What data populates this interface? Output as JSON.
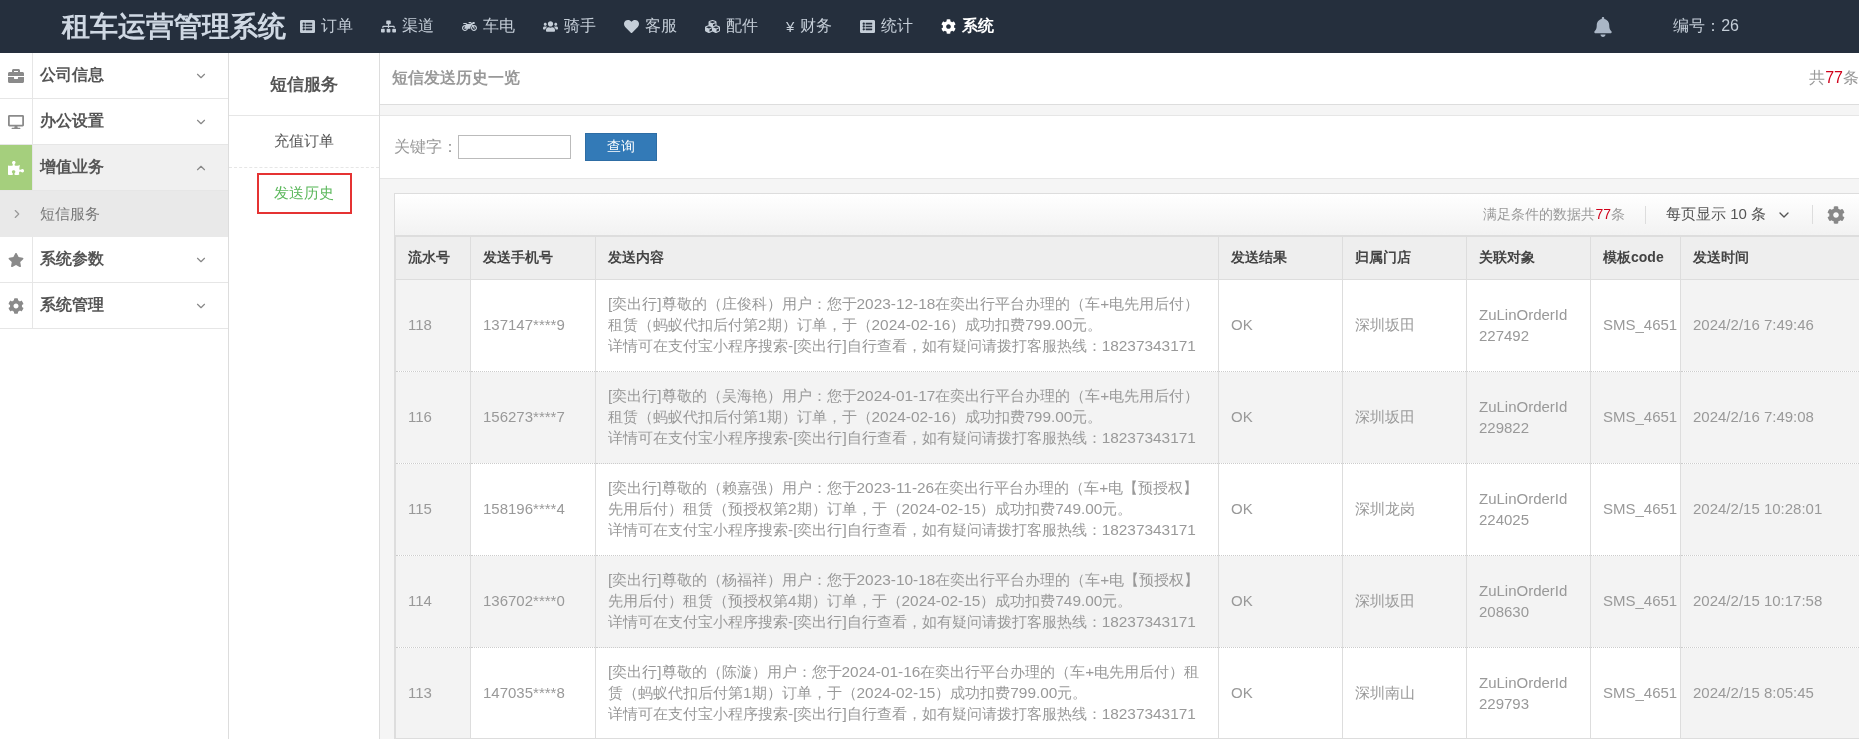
{
  "app_title": "租车运营管理系统",
  "nav": [
    {
      "label": "订单",
      "selected": false
    },
    {
      "label": "渠道",
      "selected": false
    },
    {
      "label": "车电",
      "selected": false
    },
    {
      "label": "骑手",
      "selected": false
    },
    {
      "label": "客服",
      "selected": false
    },
    {
      "label": "配件",
      "selected": false
    },
    {
      "label": "财务",
      "symbol": "¥",
      "selected": false
    },
    {
      "label": "统计",
      "selected": false
    },
    {
      "label": "系统",
      "selected": true
    }
  ],
  "user": {
    "id_label": "编号：26"
  },
  "sidebar": {
    "items": [
      {
        "label": "公司信息",
        "expanded": false,
        "selected": false
      },
      {
        "label": "办公设置",
        "expanded": false,
        "selected": false
      },
      {
        "label": "增值业务",
        "expanded": true,
        "selected": true,
        "children": [
          {
            "label": "短信服务",
            "selected": true
          }
        ]
      },
      {
        "label": "系统参数",
        "expanded": false,
        "selected": false
      },
      {
        "label": "系统管理",
        "expanded": false,
        "selected": false
      }
    ]
  },
  "subnav": {
    "title": "短信服务",
    "items": [
      {
        "label": "充值订单",
        "selected": false
      },
      {
        "label": "发送历史",
        "selected": true
      }
    ]
  },
  "page": {
    "title": "短信发送历史一览",
    "total": {
      "prefix": "共",
      "count": "77",
      "suffix": "条"
    }
  },
  "search": {
    "label": "关键字：",
    "button": "查询"
  },
  "table": {
    "summary": {
      "prefix": "满足条件的数据共",
      "count": "77",
      "suffix": "条"
    },
    "page_size": "每页显示 10 条",
    "columns": [
      "流水号",
      "发送手机号",
      "发送内容",
      "发送结果",
      "归属门店",
      "关联对象",
      "模板code",
      "发送时间"
    ],
    "rows": [
      [
        "118",
        "137147****9",
        [
          "[奕出行]尊敬的（庄俊科）用户：您于2023-12-18在奕出行平台办理的（车+电先用后付）租赁（蚂蚁代扣后付第2期）订单，于（2024-02-16）成功扣费799.00元。",
          "详情可在支付宝小程序搜索-[奕出行]自行查看，如有疑问请拨打客服热线：18237343171"
        ],
        "OK",
        "深圳坂田",
        "ZuLinOrderId 227492",
        "SMS_4651",
        "2024/2/16 7:49:46"
      ],
      [
        "116",
        "156273****7",
        [
          "[奕出行]尊敬的（吴海艳）用户：您于2024-01-17在奕出行平台办理的（车+电先用后付）租赁（蚂蚁代扣后付第1期）订单，于（2024-02-16）成功扣费799.00元。",
          "详情可在支付宝小程序搜索-[奕出行]自行查看，如有疑问请拨打客服热线：18237343171"
        ],
        "OK",
        "深圳坂田",
        "ZuLinOrderId 229822",
        "SMS_4651",
        "2024/2/16 7:49:08"
      ],
      [
        "115",
        "158196****4",
        [
          "[奕出行]尊敬的（赖嘉强）用户：您于2023-11-26在奕出行平台办理的（车+电【预授权】先用后付）租赁（预授权第2期）订单，于（2024-02-15）成功扣费749.00元。",
          "详情可在支付宝小程序搜索-[奕出行]自行查看，如有疑问请拨打客服热线：18237343171"
        ],
        "OK",
        "深圳龙岗",
        "ZuLinOrderId 224025",
        "SMS_4651",
        "2024/2/15 10:28:01"
      ],
      [
        "114",
        "136702****0",
        [
          "[奕出行]尊敬的（杨福祥）用户：您于2023-10-18在奕出行平台办理的（车+电【预授权】先用后付）租赁（预授权第4期）订单，于（2024-02-15）成功扣费749.00元。",
          "详情可在支付宝小程序搜索-[奕出行]自行查看，如有疑问请拨打客服热线：18237343171"
        ],
        "OK",
        "深圳坂田",
        "ZuLinOrderId 208630",
        "SMS_4651",
        "2024/2/15 10:17:58"
      ],
      [
        "113",
        "147035****8",
        [
          "[奕出行]尊敬的（陈漩）用户：您于2024-01-16在奕出行平台办理的（车+电先用后付）租赁（蚂蚁代扣后付第1期）订单，于（2024-02-15）成功扣费799.00元。",
          "详情可在支付宝小程序搜索-[奕出行]自行查看，如有疑问请拨打客服热线：18237343171"
        ],
        "OK",
        "深圳南山",
        "ZuLinOrderId 229793",
        "SMS_4651",
        "2024/2/15 8:05:45"
      ]
    ]
  }
}
